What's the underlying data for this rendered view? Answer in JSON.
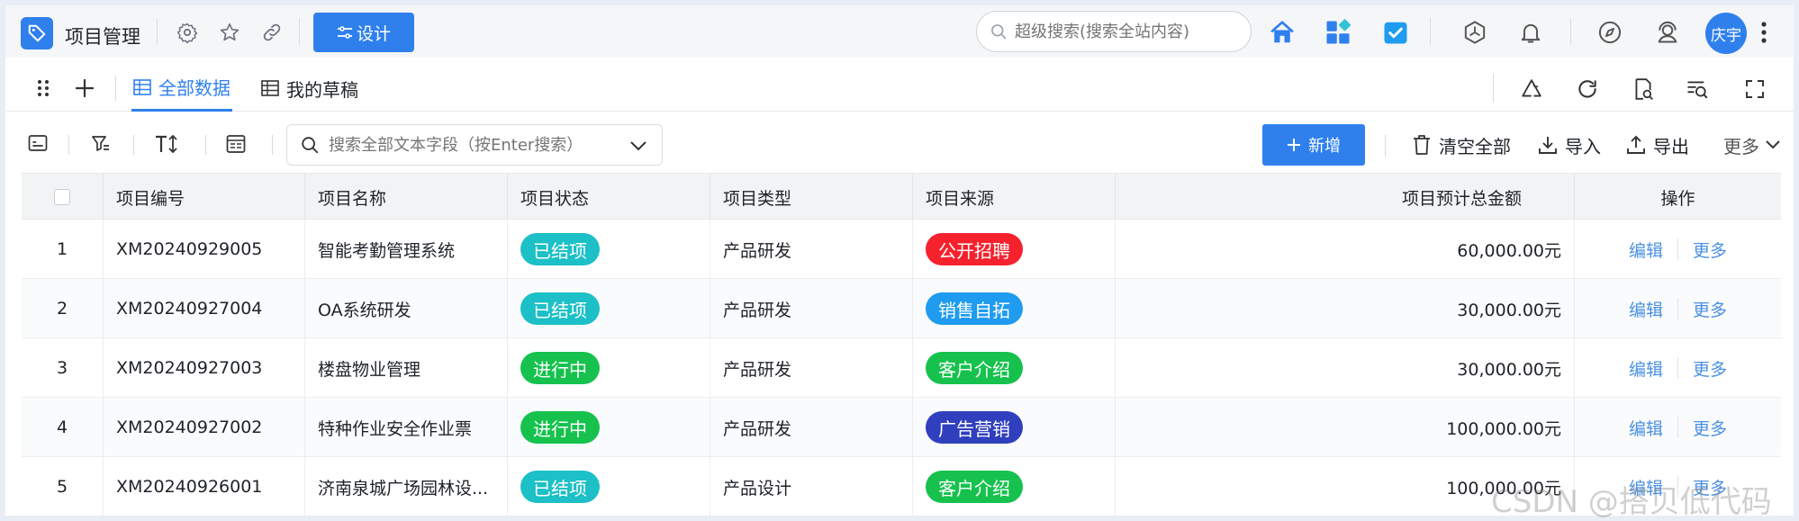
{
  "app": {
    "title": "项目管理",
    "design_label": "设计",
    "global_search_placeholder": "超级搜索(搜索全站内容)",
    "user_name": "庆宇",
    "accent": "#2f80ed"
  },
  "tabs": [
    {
      "label": "全部数据",
      "active": true
    },
    {
      "label": "我的草稿",
      "active": false
    }
  ],
  "toolbar": {
    "search_placeholder": "搜索全部文本字段（按Enter搜索）",
    "add_label": "新增",
    "clear_label": "清空全部",
    "import_label": "导入",
    "export_label": "导出",
    "more_label": "更多"
  },
  "table": {
    "columns": [
      "项目编号",
      "项目名称",
      "项目状态",
      "项目类型",
      "项目来源",
      "项目预计总金额",
      "操作"
    ],
    "rows": [
      {
        "index": "1",
        "code": "XM20240929005",
        "name": "智能考勤管理系统",
        "status": "已结项",
        "status_color": "#1cc0c6",
        "type": "产品研发",
        "source": "公开招聘",
        "source_color": "#f5222d",
        "amount": "60,000.00元",
        "edit": "编辑",
        "more": "更多"
      },
      {
        "index": "2",
        "code": "XM20240927004",
        "name": "OA系统研发",
        "status": "已结项",
        "status_color": "#1cc0c6",
        "type": "产品研发",
        "source": "销售自拓",
        "source_color": "#1f9bef",
        "amount": "30,000.00元",
        "edit": "编辑",
        "more": "更多"
      },
      {
        "index": "3",
        "code": "XM20240927003",
        "name": "楼盘物业管理",
        "status": "进行中",
        "status_color": "#16c24d",
        "type": "产品研发",
        "source": "客户介绍",
        "source_color": "#16c24d",
        "amount": "30,000.00元",
        "edit": "编辑",
        "more": "更多"
      },
      {
        "index": "4",
        "code": "XM20240927002",
        "name": "特种作业安全作业票",
        "status": "进行中",
        "status_color": "#16c24d",
        "type": "产品研发",
        "source": "广告营销",
        "source_color": "#2f3fbd",
        "amount": "100,000.00元",
        "edit": "编辑",
        "more": "更多"
      },
      {
        "index": "5",
        "code": "XM20240926001",
        "name": "济南泉城广场园林设...",
        "status": "已结项",
        "status_color": "#1cc0c6",
        "type": "产品设计",
        "source": "客户介绍",
        "source_color": "#16c24d",
        "amount": "100,000.00元",
        "edit": "编辑",
        "more": "更多"
      }
    ]
  },
  "watermark": "CSDN @搭贝低代码"
}
